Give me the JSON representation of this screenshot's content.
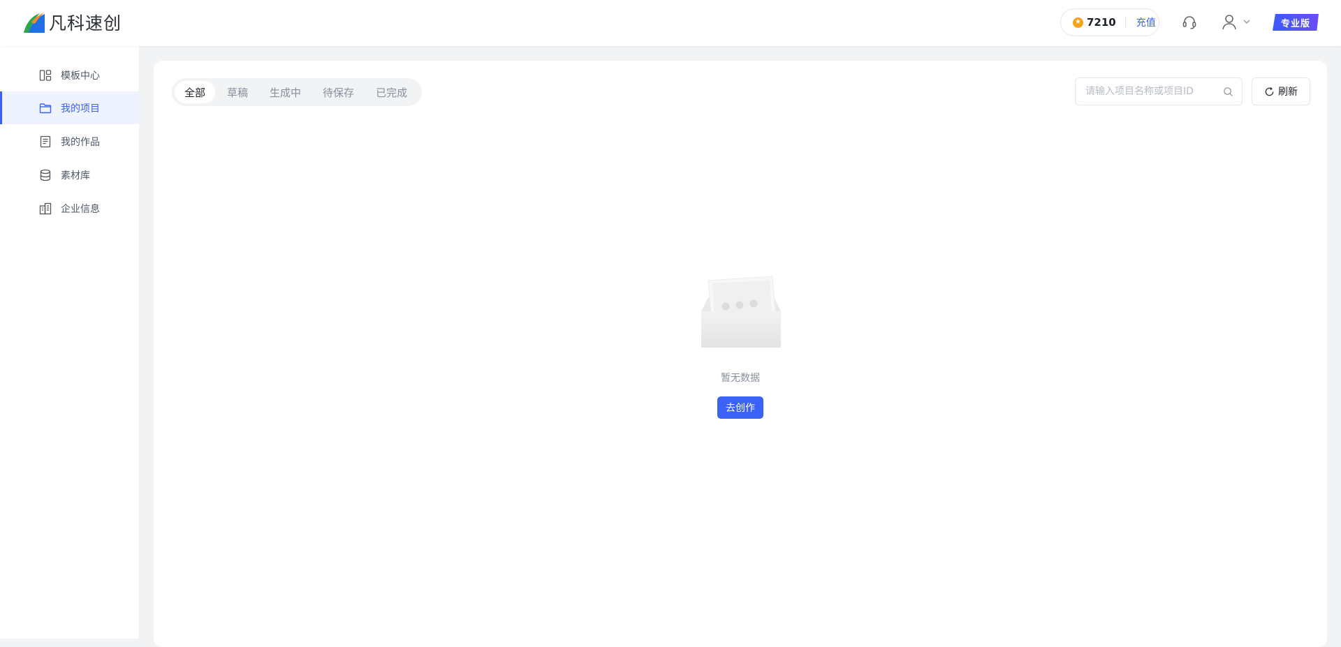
{
  "header": {
    "logo_text": "凡科速创",
    "points": "7210",
    "recharge_label": "充值",
    "pro_badge": "专业版"
  },
  "sidebar": {
    "items": [
      {
        "label": "模板中心",
        "icon": "template-icon"
      },
      {
        "label": "我的项目",
        "icon": "folder-icon",
        "active": true
      },
      {
        "label": "我的作品",
        "icon": "document-icon"
      },
      {
        "label": "素材库",
        "icon": "database-icon"
      },
      {
        "label": "企业信息",
        "icon": "building-icon"
      }
    ]
  },
  "main": {
    "tabs": [
      "全部",
      "草稿",
      "生成中",
      "待保存",
      "已完成"
    ],
    "active_tab": "全部",
    "search": {
      "placeholder": "请输入项目名称或项目ID",
      "value": ""
    },
    "refresh_label": "刷新",
    "empty": {
      "text": "暂无数据",
      "button": "去创作"
    }
  },
  "colors": {
    "accent": "#3a63f5",
    "coin": "#f7a21b",
    "active_bg": "#eef3ff"
  }
}
